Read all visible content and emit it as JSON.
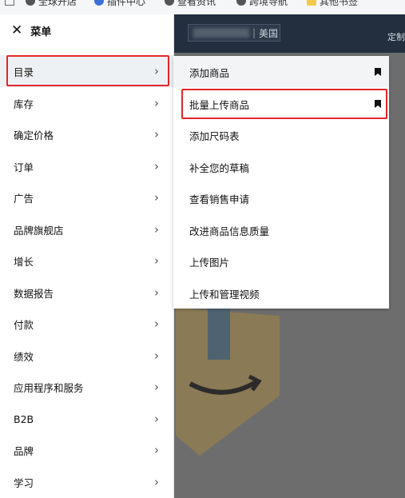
{
  "bookmarks": [
    {
      "label": "全球开店",
      "icon": "globe-icon",
      "color": "#555"
    },
    {
      "label": "插件中心",
      "icon": "plugin-icon",
      "color": "#3b6fd8"
    },
    {
      "label": "查看资讯",
      "icon": "globe-icon",
      "color": "#555"
    },
    {
      "label": "跨境导航",
      "icon": "globe-icon",
      "color": "#555"
    },
    {
      "label": "其他书签",
      "icon": "folder-icon",
      "color": "#f2c94c"
    }
  ],
  "header": {
    "marketplace": "美国",
    "right_text": "定制"
  },
  "menu": {
    "title": "菜单",
    "items": [
      {
        "label": "目录"
      },
      {
        "label": "库存"
      },
      {
        "label": "确定价格"
      },
      {
        "label": "订单"
      },
      {
        "label": "广告"
      },
      {
        "label": "品牌旗舰店"
      },
      {
        "label": "增长"
      },
      {
        "label": "数据报告"
      },
      {
        "label": "付款"
      },
      {
        "label": "绩效"
      },
      {
        "label": "应用程序和服务"
      },
      {
        "label": "B2B"
      },
      {
        "label": "品牌"
      },
      {
        "label": "学习"
      }
    ]
  },
  "submenu": {
    "items": [
      {
        "label": "添加商品",
        "bookmarked": true
      },
      {
        "label": "批量上传商品",
        "bookmarked": true
      },
      {
        "label": "添加尺码表"
      },
      {
        "label": "补全您的草稿"
      },
      {
        "label": "查看销售申请"
      },
      {
        "label": "改进商品信息质量"
      },
      {
        "label": "上传图片"
      },
      {
        "label": "上传和管理视频"
      }
    ]
  },
  "colors": {
    "highlight": "#e3262a",
    "header": "#232f3e"
  }
}
